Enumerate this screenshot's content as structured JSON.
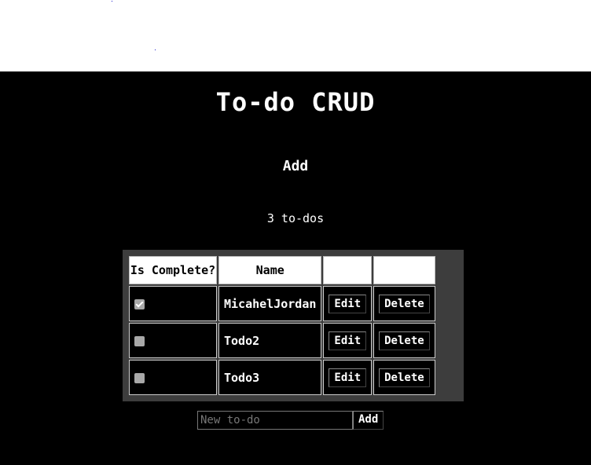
{
  "app": {
    "title": "To-do CRUD",
    "add_heading": "Add",
    "count_text": "3 to-dos"
  },
  "table": {
    "headers": [
      "Is Complete?",
      "Name",
      "",
      ""
    ],
    "rows": [
      {
        "complete": true,
        "name": "MicahelJordan",
        "edit_label": "Edit",
        "delete_label": "Delete"
      },
      {
        "complete": false,
        "name": "Todo2",
        "edit_label": "Edit",
        "delete_label": "Delete"
      },
      {
        "complete": false,
        "name": "Todo3",
        "edit_label": "Edit",
        "delete_label": "Delete"
      }
    ]
  },
  "new_todo": {
    "placeholder": "New to-do",
    "value": "",
    "add_label": "Add"
  },
  "colors": {
    "background": "#000000",
    "text": "#ffffff",
    "table_frame": "#3d3d3d",
    "checkbox": "#a8a8a8"
  }
}
